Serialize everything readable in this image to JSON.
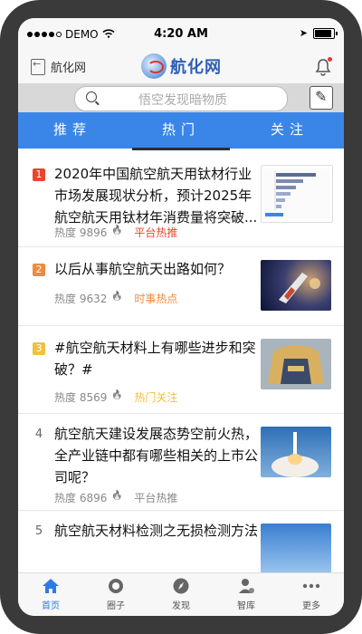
{
  "status_bar": {
    "carrier": "DEMO",
    "time": "4:20 AM"
  },
  "nav": {
    "back_label": "航化网",
    "logo_text": "航化网"
  },
  "search": {
    "placeholder": "悟空发现暗物质"
  },
  "tabs": [
    {
      "label": "推荐",
      "active": false
    },
    {
      "label": "热门",
      "active": true
    },
    {
      "label": "关注",
      "active": false
    }
  ],
  "feed": [
    {
      "rank": "1",
      "title": "2020年中国航空航天用钛材行业市场发展现状分析，预计2025年航空航天用钛材年消费量将突破...",
      "heat_label": "热度",
      "heat": "9896",
      "tag": "平台热推",
      "tag_color": "#e8462c",
      "rank_color": "#e8462c",
      "thumb": "chart-image"
    },
    {
      "rank": "2",
      "title": "以后从事航空航天出路如何？",
      "heat_label": "热度",
      "heat": "9632",
      "tag": "时事热点",
      "tag_color": "#f08a3c",
      "rank_color": "#f08a3c",
      "thumb": "space-shuttle-image"
    },
    {
      "rank": "3",
      "title": "#航空航天材料上有哪些进步和突破？#",
      "heat_label": "热度",
      "heat": "8569",
      "tag": "热门关注",
      "tag_color": "#f0c040",
      "rank_color": "#f0c040",
      "thumb": "aircraft-fuselage-image"
    },
    {
      "rank": "4",
      "title": "航空航天建设发展态势空前火热，全产业链中都有哪些相关的上市公司呢？",
      "heat_label": "热度",
      "heat": "6896",
      "tag": "平台热推",
      "tag_color": "#888888",
      "rank_color": "",
      "thumb": "rocket-launch-image"
    },
    {
      "rank": "5",
      "title": "航空航天材料检测之无损检测方法",
      "heat_label": "",
      "heat": "",
      "tag": "",
      "tag_color": "#888888",
      "rank_color": "",
      "thumb": "sky-image"
    }
  ],
  "bottom_tabs": [
    {
      "label": "首页",
      "icon": "home-icon",
      "active": true
    },
    {
      "label": "圈子",
      "icon": "circle-icon",
      "active": false
    },
    {
      "label": "发现",
      "icon": "compass-icon",
      "active": false
    },
    {
      "label": "智库",
      "icon": "person-icon",
      "active": false
    },
    {
      "label": "更多",
      "icon": "more-icon",
      "active": false
    }
  ],
  "colors": {
    "accent": "#3a86e8",
    "rank1": "#e8462c",
    "rank2": "#f08a3c",
    "rank3": "#f0c040"
  }
}
